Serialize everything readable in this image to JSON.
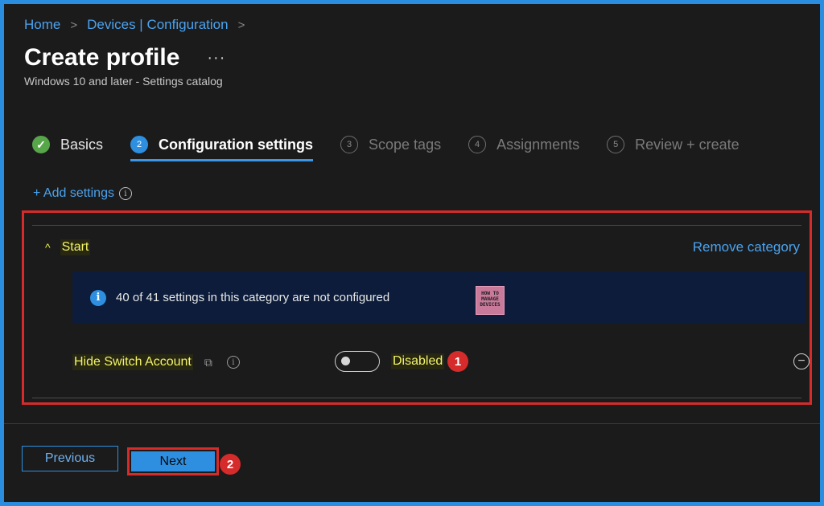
{
  "breadcrumb": {
    "home": "Home",
    "section": "Devices | Configuration",
    "sep": ">"
  },
  "header": {
    "title": "Create profile",
    "more": "···",
    "subtitle": "Windows 10 and later - Settings catalog"
  },
  "steps": [
    {
      "num": "✓",
      "label": "Basics",
      "state": "done"
    },
    {
      "num": "2",
      "label": "Configuration settings",
      "state": "active"
    },
    {
      "num": "3",
      "label": "Scope tags",
      "state": "pending"
    },
    {
      "num": "4",
      "label": "Assignments",
      "state": "pending"
    },
    {
      "num": "5",
      "label": "Review + create",
      "state": "pending"
    }
  ],
  "add_settings": {
    "label": "+ Add settings",
    "info": "i"
  },
  "category": {
    "chevron": "^",
    "title": "Start",
    "remove_label": "Remove category",
    "banner": {
      "icon": "i",
      "message": "40 of 41 settings in this category are not configured"
    },
    "logo_text": [
      "HOW TO",
      "MANAGE",
      "DEVICES"
    ],
    "setting": {
      "name": "Hide Switch Account",
      "copy_icon": "⧉",
      "info": "i",
      "toggle_state": "Disabled",
      "minus": "−"
    }
  },
  "annotations": {
    "badge1": "1",
    "badge2": "2"
  },
  "footer": {
    "previous_label": "Previous",
    "next_label": "Next"
  },
  "colors": {
    "accent": "#2e8fe0",
    "highlight": "#d62b2b",
    "success": "#57a64a"
  }
}
